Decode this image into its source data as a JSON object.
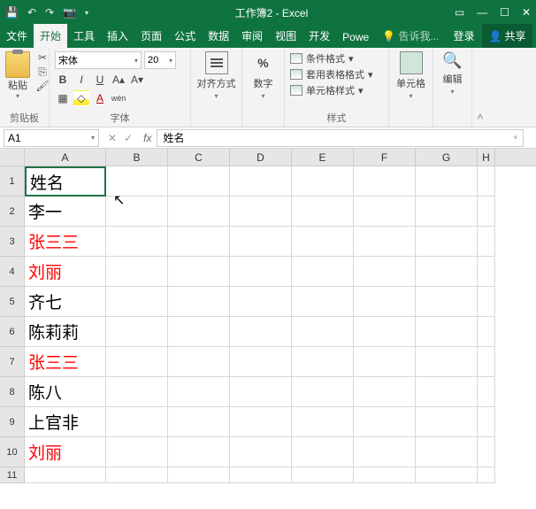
{
  "titlebar": {
    "title": "工作簿2 - Excel"
  },
  "tabs": {
    "file": "文件",
    "items": [
      "开始",
      "工具",
      "插入",
      "页面",
      "公式",
      "数据",
      "审阅",
      "视图",
      "开发",
      "Powe"
    ],
    "active": 0,
    "tellme": "告诉我...",
    "login": "登录",
    "share": "共享"
  },
  "ribbon": {
    "clipboard": {
      "label": "剪贴板",
      "paste": "粘贴"
    },
    "font": {
      "label": "字体",
      "name": "宋体",
      "size": "20",
      "b": "B",
      "i": "I",
      "u": "U",
      "wen": "wén"
    },
    "align": {
      "label": "对齐方式"
    },
    "number": {
      "label": "数字",
      "pct": "%"
    },
    "styles": {
      "label": "样式",
      "cond": "条件格式",
      "table": "套用表格格式",
      "cell": "单元格样式"
    },
    "cells": {
      "label": "单元格"
    },
    "edit": {
      "label": "编辑"
    }
  },
  "namebox": {
    "ref": "A1"
  },
  "formula": {
    "value": "姓名"
  },
  "columns": [
    "A",
    "B",
    "C",
    "D",
    "E",
    "F",
    "G",
    "H"
  ],
  "rows": [
    {
      "n": 1,
      "a": "姓名",
      "red": false
    },
    {
      "n": 2,
      "a": "李一",
      "red": false
    },
    {
      "n": 3,
      "a": "张三三",
      "red": true
    },
    {
      "n": 4,
      "a": "刘丽",
      "red": true
    },
    {
      "n": 5,
      "a": "齐七",
      "red": false
    },
    {
      "n": 6,
      "a": "陈莉莉",
      "red": false
    },
    {
      "n": 7,
      "a": "张三三",
      "red": true
    },
    {
      "n": 8,
      "a": "陈八",
      "red": false
    },
    {
      "n": 9,
      "a": "上官非",
      "red": false
    },
    {
      "n": 10,
      "a": "刘丽",
      "red": true
    },
    {
      "n": 11,
      "a": "",
      "red": false
    }
  ],
  "selected": "A1"
}
